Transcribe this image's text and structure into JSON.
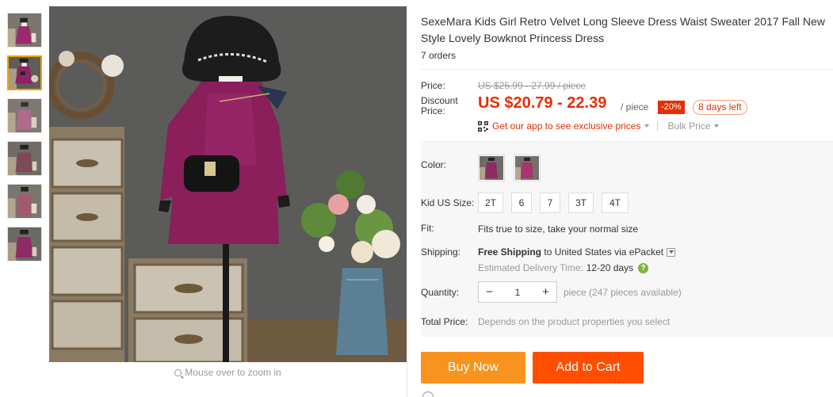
{
  "title": "SexeMara Kids Girl Retro Velvet Long Sleeve Dress Waist Sweater 2017 Fall New Style Lovely Bowknot Princess Dress",
  "orders": "7 orders",
  "zoom_hint": "Mouse over to zoom in",
  "price": {
    "price_label": "Price:",
    "original": "US $25.99 - 27.99 / piece",
    "discount_label": "Discount Price:",
    "sale": "US $20.79 - 22.39",
    "per_unit": "/ piece",
    "discount_pct": "-20%",
    "days_left": "8 days left"
  },
  "app_promo": {
    "link": "Get our app to see exclusive prices",
    "bulk": "Bulk Price"
  },
  "color": {
    "label": "Color:",
    "options": [
      "dress-color-1",
      "dress-color-2"
    ]
  },
  "size": {
    "label": "Kid US Size:",
    "options": [
      "2T",
      "6",
      "7",
      "3T",
      "4T"
    ]
  },
  "fit": {
    "label": "Fit:",
    "value": "Fits true to size, take your normal size"
  },
  "shipping": {
    "label": "Shipping:",
    "free": "Free Shipping",
    "to": "to United States via ePacket",
    "est_label": "Estimated Delivery Time:",
    "est_days": "12-20 days",
    "help": "?"
  },
  "quantity": {
    "label": "Quantity:",
    "minus": "−",
    "value": "1",
    "plus": "+",
    "available": "piece (247 pieces available)"
  },
  "total": {
    "label": "Total Price:",
    "value": "Depends on the product properties you select"
  },
  "buttons": {
    "buy_now": "Buy Now",
    "add_to_cart": "Add to Cart"
  },
  "colors": {
    "accent": "#e62e04",
    "buy": "#f7931e",
    "cart": "#ff4e00",
    "thumb_active": "#f0a300"
  }
}
